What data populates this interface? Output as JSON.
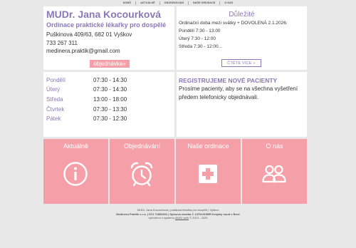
{
  "nav": [
    "DOMŮ",
    "AKTUÁLNĚ",
    "OBJEDNÁVÁNÍ",
    "NAŠE ORDINACE",
    "O NÁS"
  ],
  "contact": {
    "name": "MUDr. Jana Kocourková",
    "subtitle": "Ordinace praktické lékařky pro dospělé",
    "address": "Puškinova 409/63, 682 01 Vyškov",
    "phone": "733 267 311",
    "email": "medinera.praktik@gmail.com",
    "order_button": "objednávka»"
  },
  "important": {
    "title": "Důležité",
    "lines": [
      "Ordinační doba mezi svátky + DOVOLENÁ 2.1.2026:",
      "Pondělí 7:30 - 13:00",
      "Úterý 7:30 - 12:00",
      "Středa 7:30 - 12:00..."
    ],
    "more_button": "ČTĚTE VÍCE »"
  },
  "hours": [
    {
      "day": "Pondělí",
      "time": "07:30 - 14:30"
    },
    {
      "day": "Úterý",
      "time": "07:30 - 14:30"
    },
    {
      "day": "Středa",
      "time": "13:00 - 18:00"
    },
    {
      "day": "Čtvrtek",
      "time": "07:30 - 13:30"
    },
    {
      "day": "Pátek",
      "time": "07:30 - 12:30"
    }
  ],
  "register": {
    "title": "REGISTRUJEME NOVÉ PACIENTY",
    "text": "Prosíme pacienty, aby se na všechna vyšetření předem telefonicky objednávali."
  },
  "tiles": [
    {
      "label": "Aktuálně",
      "icon": "info-icon"
    },
    {
      "label": "Objednávání",
      "icon": "alarm-clock-icon"
    },
    {
      "label": "Naše ordinace",
      "icon": "medical-cross-icon"
    },
    {
      "label": "O nás",
      "icon": "people-icon"
    }
  ],
  "footer": {
    "line1": "MUDr. Jana Kocourková | praktická lékařka pro dospělé | Vyškov",
    "line2": "Medinera Praktik s.r.o. | IČO 72854301 | Spisová značka C 13791/KSBR Krajský soud v Brně",
    "line3_prefix": "vytvořeno v systému",
    "line3_link": "MUDr web",
    "line3_suffix": "© 2013 - 2026"
  },
  "colors": {
    "accent": "#8878b8",
    "tile": "#f5a0a8",
    "background": "#e8e8e8"
  }
}
